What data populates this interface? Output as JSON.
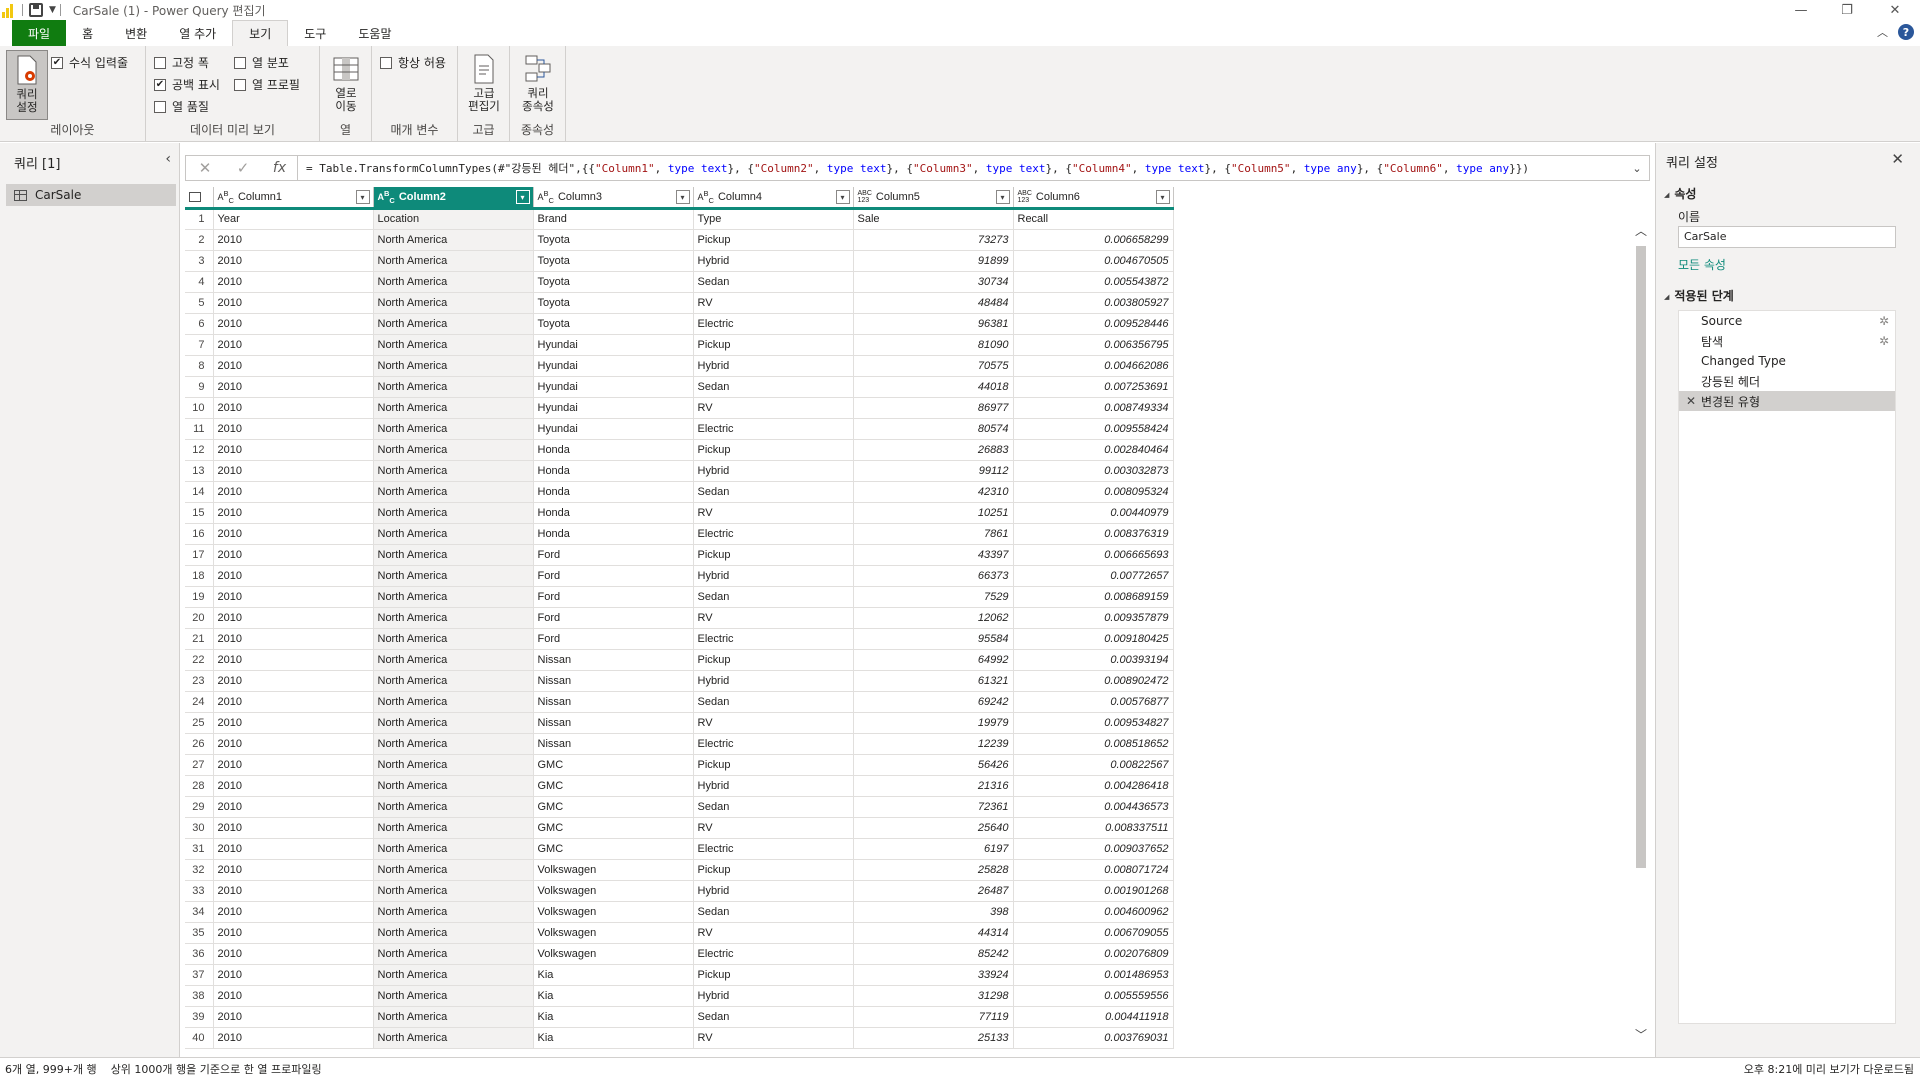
{
  "window": {
    "title": "CarSale (1) - Power Query 편집기"
  },
  "ribbon": {
    "tabs": [
      "파일",
      "홈",
      "변환",
      "열 추가",
      "보기",
      "도구",
      "도움말"
    ],
    "active_tab": "보기",
    "layout": {
      "query_settings": "쿼리\n설정",
      "formula_bar": "수식 입력줄",
      "group": "레이아웃"
    },
    "preview": {
      "monospace": "고정 폭",
      "show_whitespace": "공백 표시",
      "column_quality": "열 품질",
      "column_distribution": "열 분포",
      "column_profile": "열 프로필",
      "group": "데이터 미리 보기"
    },
    "columns": {
      "goto_column": "열로\n이동",
      "group": "열"
    },
    "parameters": {
      "always_allow": "항상 허용",
      "group": "매개 변수"
    },
    "advanced": {
      "advanced_editor": "고급\n편집기",
      "group": "고급"
    },
    "dependencies": {
      "query_dependencies": "쿼리\n종속성",
      "group": "종속성"
    },
    "checks": {
      "formula_bar": true,
      "monospace": false,
      "show_whitespace": true,
      "column_quality": false,
      "column_distribution": false,
      "column_profile": false,
      "always_allow": false
    }
  },
  "left_pane": {
    "title": "쿼리 [1]",
    "query": "CarSale"
  },
  "formula": {
    "text_parts": [
      {
        "t": "= Table.TransformColumnTypes(#\"강등된 헤더\",{{",
        "c": ""
      },
      {
        "t": "\"Column1\"",
        "c": "str"
      },
      {
        "t": ", ",
        "c": ""
      },
      {
        "t": "type",
        "c": "kw"
      },
      {
        "t": " text",
        "c": "kw"
      },
      {
        "t": "}, {",
        "c": ""
      },
      {
        "t": "\"Column2\"",
        "c": "str"
      },
      {
        "t": ", ",
        "c": ""
      },
      {
        "t": "type",
        "c": "kw"
      },
      {
        "t": " text",
        "c": "kw"
      },
      {
        "t": "}, {",
        "c": ""
      },
      {
        "t": "\"Column3\"",
        "c": "str"
      },
      {
        "t": ", ",
        "c": ""
      },
      {
        "t": "type",
        "c": "kw"
      },
      {
        "t": " text",
        "c": "kw"
      },
      {
        "t": "}, {",
        "c": ""
      },
      {
        "t": "\"Column4\"",
        "c": "str"
      },
      {
        "t": ", ",
        "c": ""
      },
      {
        "t": "type",
        "c": "kw"
      },
      {
        "t": " text",
        "c": "kw"
      },
      {
        "t": "}, {",
        "c": ""
      },
      {
        "t": "\"Column5\"",
        "c": "str"
      },
      {
        "t": ", ",
        "c": ""
      },
      {
        "t": "type",
        "c": "kw"
      },
      {
        "t": " any",
        "c": "kw"
      },
      {
        "t": "}, {",
        "c": ""
      },
      {
        "t": "\"Column6\"",
        "c": "str"
      },
      {
        "t": ", ",
        "c": ""
      },
      {
        "t": "type",
        "c": "kw"
      },
      {
        "t": " any",
        "c": "kw"
      },
      {
        "t": "}})",
        "c": ""
      }
    ]
  },
  "grid": {
    "columns": [
      {
        "name": "Column1",
        "type": "ABC"
      },
      {
        "name": "Column2",
        "type": "ABC"
      },
      {
        "name": "Column3",
        "type": "ABC"
      },
      {
        "name": "Column4",
        "type": "ABC"
      },
      {
        "name": "Column5",
        "type": "ABC123"
      },
      {
        "name": "Column6",
        "type": "ABC123"
      }
    ],
    "selected_column": 1,
    "header_row": [
      "Year",
      "Location",
      "Brand",
      "Type",
      "Sale",
      "Recall"
    ],
    "rows": [
      [
        "2010",
        "North America",
        "Toyota",
        "Pickup",
        "73273",
        "0.006658299"
      ],
      [
        "2010",
        "North America",
        "Toyota",
        "Hybrid",
        "91899",
        "0.004670505"
      ],
      [
        "2010",
        "North America",
        "Toyota",
        "Sedan",
        "30734",
        "0.005543872"
      ],
      [
        "2010",
        "North America",
        "Toyota",
        "RV",
        "48484",
        "0.003805927"
      ],
      [
        "2010",
        "North America",
        "Toyota",
        "Electric",
        "96381",
        "0.009528446"
      ],
      [
        "2010",
        "North America",
        "Hyundai",
        "Pickup",
        "81090",
        "0.006356795"
      ],
      [
        "2010",
        "North America",
        "Hyundai",
        "Hybrid",
        "70575",
        "0.004662086"
      ],
      [
        "2010",
        "North America",
        "Hyundai",
        "Sedan",
        "44018",
        "0.007253691"
      ],
      [
        "2010",
        "North America",
        "Hyundai",
        "RV",
        "86977",
        "0.008749334"
      ],
      [
        "2010",
        "North America",
        "Hyundai",
        "Electric",
        "80574",
        "0.009558424"
      ],
      [
        "2010",
        "North America",
        "Honda",
        "Pickup",
        "26883",
        "0.002840464"
      ],
      [
        "2010",
        "North America",
        "Honda",
        "Hybrid",
        "99112",
        "0.003032873"
      ],
      [
        "2010",
        "North America",
        "Honda",
        "Sedan",
        "42310",
        "0.008095324"
      ],
      [
        "2010",
        "North America",
        "Honda",
        "RV",
        "10251",
        "0.00440979"
      ],
      [
        "2010",
        "North America",
        "Honda",
        "Electric",
        "7861",
        "0.008376319"
      ],
      [
        "2010",
        "North America",
        "Ford",
        "Pickup",
        "43397",
        "0.006665693"
      ],
      [
        "2010",
        "North America",
        "Ford",
        "Hybrid",
        "66373",
        "0.00772657"
      ],
      [
        "2010",
        "North America",
        "Ford",
        "Sedan",
        "7529",
        "0.008689159"
      ],
      [
        "2010",
        "North America",
        "Ford",
        "RV",
        "12062",
        "0.009357879"
      ],
      [
        "2010",
        "North America",
        "Ford",
        "Electric",
        "95584",
        "0.009180425"
      ],
      [
        "2010",
        "North America",
        "Nissan",
        "Pickup",
        "64992",
        "0.00393194"
      ],
      [
        "2010",
        "North America",
        "Nissan",
        "Hybrid",
        "61321",
        "0.008902472"
      ],
      [
        "2010",
        "North America",
        "Nissan",
        "Sedan",
        "69242",
        "0.00576877"
      ],
      [
        "2010",
        "North America",
        "Nissan",
        "RV",
        "19979",
        "0.009534827"
      ],
      [
        "2010",
        "North America",
        "Nissan",
        "Electric",
        "12239",
        "0.008518652"
      ],
      [
        "2010",
        "North America",
        "GMC",
        "Pickup",
        "56426",
        "0.00822567"
      ],
      [
        "2010",
        "North America",
        "GMC",
        "Hybrid",
        "21316",
        "0.004286418"
      ],
      [
        "2010",
        "North America",
        "GMC",
        "Sedan",
        "72361",
        "0.004436573"
      ],
      [
        "2010",
        "North America",
        "GMC",
        "RV",
        "25640",
        "0.008337511"
      ],
      [
        "2010",
        "North America",
        "GMC",
        "Electric",
        "6197",
        "0.009037652"
      ],
      [
        "2010",
        "North America",
        "Volkswagen",
        "Pickup",
        "25828",
        "0.008071724"
      ],
      [
        "2010",
        "North America",
        "Volkswagen",
        "Hybrid",
        "26487",
        "0.001901268"
      ],
      [
        "2010",
        "North America",
        "Volkswagen",
        "Sedan",
        "398",
        "0.004600962"
      ],
      [
        "2010",
        "North America",
        "Volkswagen",
        "RV",
        "44314",
        "0.006709055"
      ],
      [
        "2010",
        "North America",
        "Volkswagen",
        "Electric",
        "85242",
        "0.002076809"
      ],
      [
        "2010",
        "North America",
        "Kia",
        "Pickup",
        "33924",
        "0.001486953"
      ],
      [
        "2010",
        "North America",
        "Kia",
        "Hybrid",
        "31298",
        "0.005559556"
      ],
      [
        "2010",
        "North America",
        "Kia",
        "Sedan",
        "77119",
        "0.004411918"
      ],
      [
        "2010",
        "North America",
        "Kia",
        "RV",
        "25133",
        "0.003769031"
      ]
    ]
  },
  "right_pane": {
    "title": "쿼리 설정",
    "properties_label": "속성",
    "name_label": "이름",
    "name_value": "CarSale",
    "all_properties": "모든 속성",
    "steps_label": "적용된 단계",
    "steps": [
      {
        "name": "Source",
        "gear": true
      },
      {
        "name": "탐색",
        "gear": true
      },
      {
        "name": "Changed Type",
        "gear": false
      },
      {
        "name": "강등된 헤더",
        "gear": false
      },
      {
        "name": "변경된 유형",
        "gear": false,
        "active": true
      }
    ]
  },
  "status": {
    "left1": "6개 열, 999+개 행",
    "left2": "상위 1000개 행을 기준으로 한 열 프로파일링",
    "right": "오후 8:21에 미리 보기가 다운로드됨"
  },
  "colors": {
    "file_tab": "#107c10",
    "accent": "#0e8a7a",
    "pbi_yellow": "#f2c811"
  }
}
